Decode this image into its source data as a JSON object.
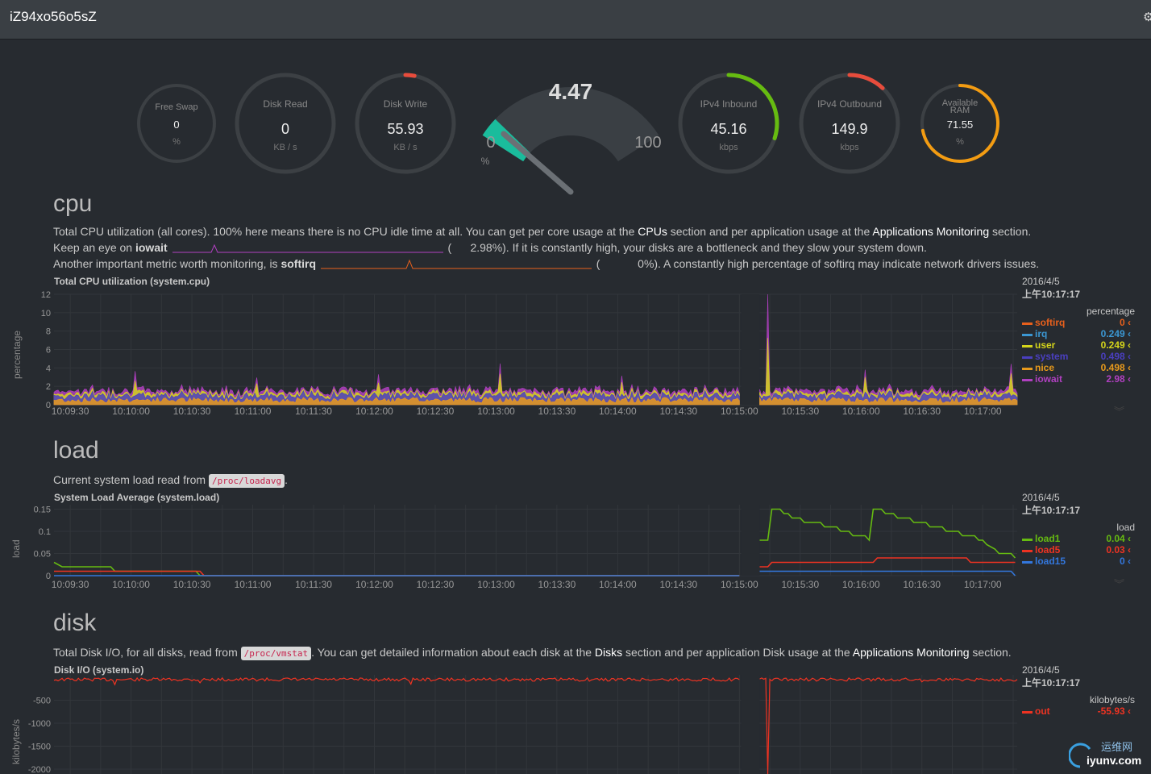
{
  "header": {
    "hostname": "iZ94xo56o5sZ"
  },
  "gauges": [
    {
      "title": "Free Swap",
      "value": "0",
      "unit": "%",
      "level": 0
    },
    {
      "title": "Disk Read",
      "value": "0",
      "unit": "KB / s",
      "level": 0
    },
    {
      "title": "Disk Write",
      "value": "55.93",
      "unit": "KB / s",
      "level": 0.03
    },
    {
      "title": "IPv4 Inbound",
      "value": "45.16",
      "unit": "kbps",
      "level": 0.3
    },
    {
      "title": "IPv4 Outbound",
      "value": "149.9",
      "unit": "kbps",
      "level": 0.12
    },
    {
      "title": "Available RAM",
      "title_line1": "Available",
      "title_line2": "RAM",
      "value": "71.55",
      "unit": "%",
      "level": 0.72
    }
  ],
  "cpu_gauge": {
    "value": "4.47",
    "min": "0",
    "max": "100",
    "unit": "%",
    "level": 0.0447
  },
  "cpu": {
    "title": "cpu",
    "desc1_a": "Total CPU utilization (all cores). 100% here means there is no CPU idle time at all. You can get per core usage at the ",
    "desc1_link1": "CPUs",
    "desc1_b": " section and per application usage at the ",
    "desc1_link2": "Applications Monitoring",
    "desc1_c": " section.",
    "desc2_a": "Keep an eye on ",
    "desc2_bold": "iowait",
    "desc2_paren": "(",
    "desc2_b": "2.98%). If it is constantly high, your disks are a bottleneck and they slow your system down.",
    "desc3_a": "Another important metric worth monitoring, is ",
    "desc3_bold": "softirq",
    "desc3_paren": "(",
    "desc3_b": "0%). A constantly high percentage of softirq may indicate network drivers issues.",
    "chart_title": "Total CPU utilization (system.cpu)",
    "ylabel": "percentage",
    "legend_date": "2016/4/5",
    "legend_time": "上午10:17:17",
    "legend_units": "percentage",
    "legend": [
      {
        "name": "softirq",
        "value": "0",
        "color": "#e8601c"
      },
      {
        "name": "irq",
        "value": "0.249",
        "color": "#3b97d3"
      },
      {
        "name": "user",
        "value": "0.249",
        "color": "#d5d51b"
      },
      {
        "name": "system",
        "value": "0.498",
        "color": "#4a3fbf"
      },
      {
        "name": "nice",
        "value": "0.498",
        "color": "#e89a1c"
      },
      {
        "name": "iowait",
        "value": "2.98",
        "color": "#b040c0"
      }
    ]
  },
  "load": {
    "title": "load",
    "desc_a": "Current system load read from ",
    "desc_code": "/proc/loadavg",
    "desc_b": ".",
    "chart_title": "System Load Average (system.load)",
    "ylabel": "load",
    "legend_date": "2016/4/5",
    "legend_time": "上午10:17:17",
    "legend_units": "load",
    "legend": [
      {
        "name": "load1",
        "value": "0.04",
        "color": "#66bb11"
      },
      {
        "name": "load5",
        "value": "0.03",
        "color": "#ee3322"
      },
      {
        "name": "load15",
        "value": "0",
        "color": "#3377dd"
      }
    ]
  },
  "disk": {
    "title": "disk",
    "desc_a": "Total Disk I/O, for all disks, read from ",
    "desc_code": "/proc/vmstat",
    "desc_b": ". You can get detailed information about each disk at the ",
    "desc_link1": "Disks",
    "desc_c": " section and per application Disk usage at the ",
    "desc_link2": "Applications Monitoring",
    "desc_d": " section.",
    "chart_title": "Disk I/O (system.io)",
    "ylabel": "kilobytes/s",
    "legend_date": "2016/4/5",
    "legend_time": "上午10:17:17",
    "legend_units": "kilobytes/s",
    "legend": [
      {
        "name": "out",
        "value": "-55.93",
        "color": "#ee3322"
      }
    ]
  },
  "chart_data": [
    {
      "type": "area",
      "title": "Total CPU utilization (system.cpu)",
      "ylabel": "percentage",
      "ylim": [
        0,
        12
      ],
      "yticks": [
        "0",
        "2",
        "4",
        "6",
        "8",
        "10",
        "12"
      ],
      "xticks": [
        "10:09:30",
        "10:10:00",
        "10:10:30",
        "10:11:00",
        "10:11:30",
        "10:12:00",
        "10:12:30",
        "10:13:00",
        "10:13:30",
        "10:14:00",
        "10:14:30",
        "10:15:00",
        "10:15:30",
        "10:16:00",
        "10:16:30",
        "10:17:00"
      ],
      "x_start": "10:09:22",
      "x_end": "10:17:17",
      "gap": [
        "10:15:00",
        "10:15:10"
      ],
      "series": [
        {
          "name": "nice",
          "baseline": 0.5,
          "color": "#e89a1c"
        },
        {
          "name": "system",
          "baseline": 0.5,
          "color": "#4a3fbf"
        },
        {
          "name": "user",
          "baseline": 0.25,
          "color": "#d5d51b"
        },
        {
          "name": "iowait",
          "baseline": 0.3,
          "color": "#b040c0",
          "spikes": [
            [
              "10:15:14",
              12
            ]
          ]
        }
      ],
      "spikes_total": [
        [
          "10:10:02",
          3.0
        ],
        [
          "10:11:02",
          2.5
        ],
        [
          "10:12:02",
          2.8
        ],
        [
          "10:13:02",
          3.3
        ],
        [
          "10:14:02",
          2.3
        ],
        [
          "10:15:14",
          12
        ],
        [
          "10:16:02",
          2.6
        ],
        [
          "10:17:14",
          4.2
        ]
      ]
    },
    {
      "type": "line",
      "title": "System Load Average (system.load)",
      "ylabel": "load",
      "ylim": [
        0,
        0.16
      ],
      "yticks": [
        "0",
        "0.05",
        "0.1",
        "0.15"
      ],
      "xticks": [
        "10:09:30",
        "10:10:00",
        "10:10:30",
        "10:11:00",
        "10:11:30",
        "10:12:00",
        "10:12:30",
        "10:13:00",
        "10:13:30",
        "10:14:00",
        "10:14:30",
        "10:15:00",
        "10:15:30",
        "10:16:00",
        "10:16:30",
        "10:17:00"
      ],
      "x_start": "10:09:22",
      "x_end": "10:17:17",
      "gap": [
        "10:15:00",
        "10:15:10"
      ],
      "series": [
        {
          "name": "load1",
          "color": "#66bb11",
          "points": [
            [
              "10:09:22",
              0.03
            ],
            [
              "10:09:26",
              0.02
            ],
            [
              "10:09:50",
              0.02
            ],
            [
              "10:09:52",
              0.01
            ],
            [
              "10:10:32",
              0.01
            ],
            [
              "10:10:34",
              0
            ],
            [
              "10:15:00",
              0
            ],
            [
              "10:15:10",
              0.08
            ],
            [
              "10:15:14",
              0.08
            ],
            [
              "10:15:16",
              0.15
            ],
            [
              "10:15:20",
              0.15
            ],
            [
              "10:15:22",
              0.14
            ],
            [
              "10:15:24",
              0.14
            ],
            [
              "10:15:26",
              0.13
            ],
            [
              "10:15:30",
              0.13
            ],
            [
              "10:15:32",
              0.12
            ],
            [
              "10:15:40",
              0.12
            ],
            [
              "10:15:42",
              0.11
            ],
            [
              "10:15:48",
              0.11
            ],
            [
              "10:15:50",
              0.1
            ],
            [
              "10:15:54",
              0.1
            ],
            [
              "10:15:56",
              0.09
            ],
            [
              "10:16:02",
              0.09
            ],
            [
              "10:16:04",
              0.08
            ],
            [
              "10:16:06",
              0.15
            ],
            [
              "10:16:10",
              0.15
            ],
            [
              "10:16:12",
              0.14
            ],
            [
              "10:16:16",
              0.14
            ],
            [
              "10:16:18",
              0.13
            ],
            [
              "10:16:24",
              0.13
            ],
            [
              "10:16:26",
              0.12
            ],
            [
              "10:16:32",
              0.12
            ],
            [
              "10:16:34",
              0.11
            ],
            [
              "10:16:40",
              0.11
            ],
            [
              "10:16:42",
              0.1
            ],
            [
              "10:16:48",
              0.1
            ],
            [
              "10:16:50",
              0.09
            ],
            [
              "10:16:56",
              0.09
            ],
            [
              "10:16:58",
              0.08
            ],
            [
              "10:17:00",
              0.08
            ],
            [
              "10:17:02",
              0.07
            ],
            [
              "10:17:06",
              0.06
            ],
            [
              "10:17:08",
              0.05
            ],
            [
              "10:17:14",
              0.05
            ],
            [
              "10:17:16",
              0.04
            ]
          ]
        },
        {
          "name": "load5",
          "color": "#ee3322",
          "points": [
            [
              "10:09:22",
              0.01
            ],
            [
              "10:10:34",
              0.01
            ],
            [
              "10:10:36",
              0
            ],
            [
              "10:15:00",
              0
            ],
            [
              "10:15:10",
              0.02
            ],
            [
              "10:15:14",
              0.02
            ],
            [
              "10:15:16",
              0.03
            ],
            [
              "10:16:06",
              0.03
            ],
            [
              "10:16:08",
              0.04
            ],
            [
              "10:16:52",
              0.04
            ],
            [
              "10:16:54",
              0.03
            ],
            [
              "10:17:16",
              0.03
            ]
          ]
        },
        {
          "name": "load15",
          "color": "#3377dd",
          "points": [
            [
              "10:09:22",
              0
            ],
            [
              "10:15:00",
              0
            ],
            [
              "10:15:10",
              0.01
            ],
            [
              "10:17:14",
              0.01
            ],
            [
              "10:17:16",
              0
            ]
          ]
        }
      ]
    },
    {
      "type": "line",
      "title": "Disk I/O (system.io)",
      "ylabel": "kilobytes/s",
      "ylim": [
        -2000,
        0
      ],
      "yticks": [
        "-500",
        "-1000",
        "-1500",
        "-2000"
      ],
      "x_start": "10:09:22",
      "x_end": "10:17:17",
      "gap": [
        "10:15:00",
        "10:15:10"
      ],
      "series": [
        {
          "name": "out",
          "color": "#ee3322",
          "baseline": -50,
          "spikes": [
            [
              "10:09:52",
              -160
            ],
            [
              "10:10:34",
              -120
            ],
            [
              "10:12:18",
              -150
            ],
            [
              "10:15:14",
              -2200
            ],
            [
              "10:16:30",
              -100
            ]
          ]
        }
      ]
    }
  ]
}
